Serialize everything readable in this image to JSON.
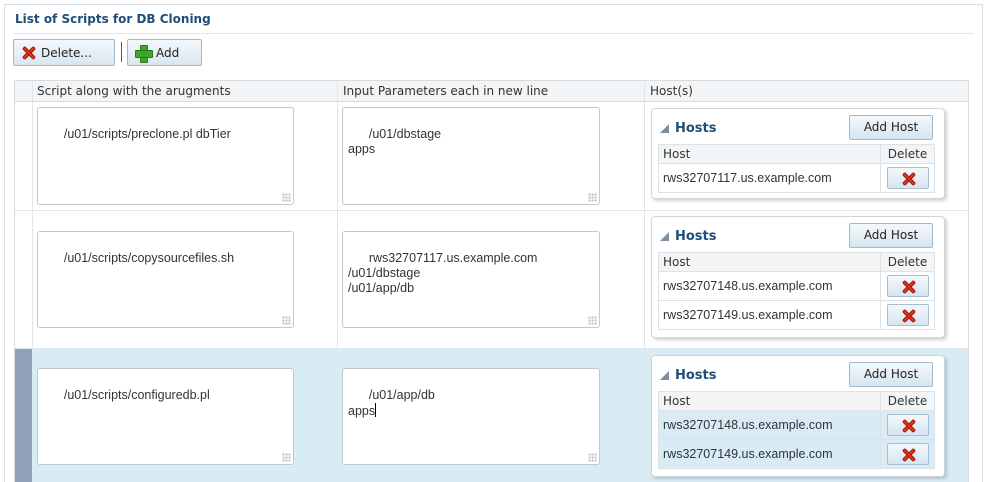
{
  "panel": {
    "title": "List of Scripts for DB Cloning"
  },
  "toolbar": {
    "delete_label": "Delete...",
    "add_label": "Add"
  },
  "columns": {
    "script": "Script along with the arugments",
    "params": "Input Parameters each in new line",
    "hosts": "Host(s)"
  },
  "hosts_panel": {
    "title": "Hosts",
    "add_label": "Add Host",
    "col_host": "Host",
    "col_delete": "Delete"
  },
  "rows": [
    {
      "script": "/u01/scripts/preclone.pl dbTier",
      "params": "/u01/dbstage\napps",
      "hosts": [
        "rws32707117.us.example.com"
      ]
    },
    {
      "script": "/u01/scripts/copysourcefiles.sh",
      "params": "rws32707117.us.example.com\n/u01/dbstage\n/u01/app/db",
      "hosts": [
        "rws32707148.us.example.com",
        "rws32707149.us.example.com"
      ]
    },
    {
      "script": "/u01/scripts/configuredb.pl",
      "params": "/u01/app/db\napps",
      "hosts": [
        "rws32707148.us.example.com",
        "rws32707149.us.example.com"
      ],
      "selected": true
    }
  ],
  "icons": {
    "delete": "red-x-icon",
    "add": "green-plus-icon",
    "collapse": "collapse-triangle-icon"
  },
  "colors": {
    "title": "#1f4e79",
    "selected_row": "#d9ecf5",
    "selection_bar": "#8ea1b6"
  }
}
